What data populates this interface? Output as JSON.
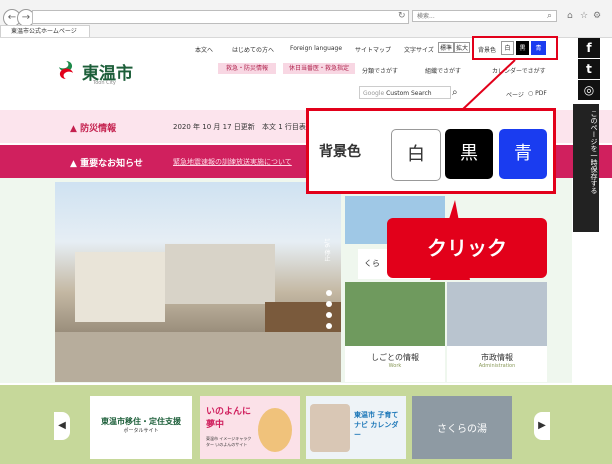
{
  "browser": {
    "tab_title": "東温市公式ホームページ",
    "search_placeholder": "検索...",
    "back_glyph": "←",
    "forward_glyph": "→"
  },
  "header": {
    "util_links": [
      "本文へ",
      "はじめての方へ",
      "Foreign language",
      "サイトマップ"
    ],
    "font_size_label": "文字サイズ",
    "font_size_options": [
      "標準",
      "拡大"
    ],
    "bg_label": "背景色",
    "bg_options": [
      "白",
      "黒",
      "青"
    ],
    "logo_title": "東温市",
    "logo_sub": "Toon City",
    "pink_buttons": [
      "救急・防災情報",
      "休日当番医・救急指定"
    ],
    "find_links": [
      "分類でさがす",
      "組織でさがす",
      "カレンダーでさがす"
    ],
    "search_label": "Custom Search",
    "search_brand": "Google",
    "this_page_label": "ページ",
    "pdf_label": "PDF"
  },
  "alerts": {
    "disaster_label": "防災情報",
    "disaster_date": "2020 年 10 月 17 日更新",
    "disaster_text": "本文 1 行目表",
    "important_label": "重要なお知らせ",
    "important_text": "緊急地震速報の訓練放送実施について"
  },
  "tiles": {
    "kurashi": "くら",
    "work": "しごとの情報",
    "work_en": "Work",
    "admin": "市政情報",
    "admin_en": "Administration"
  },
  "slider": {
    "vertical_label": "1/6 停止"
  },
  "banners": [
    {
      "title": "東温市移住・定住支援",
      "sub": "ポータルサイト"
    },
    {
      "title": "いのよんに 夢中",
      "sub": "東温市 イメージキャラクター いのよんのサイト"
    },
    {
      "title": "東温市 子育てナビ カレンダー",
      "sub": ""
    },
    {
      "title": "さくらの湯",
      "sub": ""
    }
  ],
  "side_save": "このページを一時保存する",
  "zoom": {
    "label": "背景色",
    "options": [
      "白",
      "黒",
      "青"
    ]
  },
  "callout": "クリック",
  "colors": {
    "accent_red": "#e2001a",
    "brand_green": "#1d5f3a",
    "alert_pink": "#d0205e",
    "bg_black": "#000000",
    "bg_blue": "#1a3cf0"
  }
}
